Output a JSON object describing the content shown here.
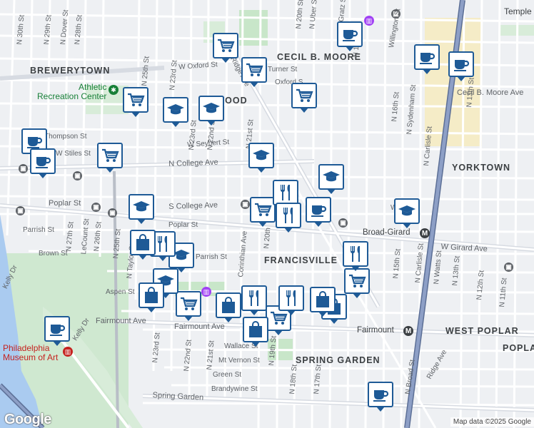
{
  "map": {
    "attribution": "Map data ©2025 Google",
    "logo": "Google",
    "colors": {
      "background": "#eef0f3",
      "park": "#c8e6c9",
      "water": "#aacbf0",
      "highway": "#8d9fc6",
      "marker_border": "#1e5a96",
      "marker_icon": "#1e5a96"
    }
  },
  "areas": {
    "brewerytown": "BREWERYTOWN",
    "cecil_b_moore": "CECIL B. MOORE",
    "yorktown": "YORKTOWN",
    "francisville": "FRANCISVILLE",
    "west_poplar": "WEST POPLAR",
    "spring_garden": "SPRING GARDEN",
    "poplar_partial": "POPLA",
    "sharswood_partial": "AWOOD",
    "temple_partial": "Temple"
  },
  "pois": {
    "athletic_rec_line1": "Athletic",
    "athletic_rec_line2": "Recreation Center",
    "museum_line1": "Philadelphia",
    "museum_line2": "Museum of Art",
    "broad_girard": "Broad-Girard",
    "fairmount_station": "Fairmount"
  },
  "streets": {
    "n30": "N 30th St",
    "n29": "N 29th St",
    "ndover": "N Dover St",
    "n28": "N 28th St",
    "n25": "N 25th St",
    "n23": "N 23rd St",
    "n22": "N 22nd St",
    "n21": "N 21st St",
    "n20": "N 20th St",
    "n20b": "N 20th",
    "n19": "N 19th St",
    "n18": "N 18th St",
    "n17": "N 17th St",
    "n16": "N 16th St",
    "nsydenham": "N Sydenham St",
    "ncarlisle": "N Carlisle St",
    "ncarlisle2": "N Carlisle St",
    "n15": "N 15th St",
    "n13": "N 13th St",
    "n13b": "N 13th St",
    "n12": "N 12th St",
    "n11": "N 11th St",
    "nwatts": "N Watts St",
    "nbroad": "N Broad St",
    "nuber": "N Uber St",
    "nopitz": "N Gratz St",
    "willington": "Willington St",
    "wthompson": "Thompson St",
    "wstiles": "W Stiles St",
    "wseybert": "W Seybert St",
    "wseybert_partial": "W S",
    "wgirard": "W Girard Ave",
    "wgirard2": "W Girard Ave",
    "woxford": "W Oxford St",
    "oxford_partial": "Oxford S",
    "turner": "Turner St",
    "cecilmoore_ave": "Cecil B. Moore Ave",
    "ncollege": "N College Ave",
    "scollege": "S College Ave",
    "poplar": "Poplar St",
    "poplar2": "Poplar St",
    "parrish": "Parrish St",
    "parrish2": "Parrish St",
    "brown": "Brown St",
    "aspen": "Aspen St",
    "fairmount_ave": "Fairmount Ave",
    "fairmount_ave2": "Fairmount Ave",
    "wallace": "Wallace St",
    "mtvernon": "Mt Vernon St",
    "green": "Green St",
    "brandywine": "Brandywine St",
    "springgarden": "Spring Garden",
    "ridge": "Ridge Ave",
    "ridge2": "Ridge Ave",
    "corinthian": "Corinthian Ave",
    "lecount": "LeCount St",
    "n27": "N 27th St",
    "n26": "N 26th St",
    "ntaylor": "N Taylor St",
    "kelly": "Kelly Dr",
    "kelly_partial": "Kelly Dr",
    "n23b": "N 23rd St",
    "n22b": "N 22nd St",
    "n21b": "N 21st St",
    "n19b": "N 19th St",
    "n17b": "N 17th St",
    "n18b": "N 18th St",
    "n15b": "N 15th St",
    "college_partial": "Ave"
  },
  "markers": [
    {
      "type": "cafe",
      "name": "cafe-marker"
    },
    {
      "type": "cafe",
      "name": "cafe-marker"
    },
    {
      "type": "cafe",
      "name": "cafe-marker"
    },
    {
      "type": "cafe",
      "name": "cafe-marker"
    },
    {
      "type": "cafe",
      "name": "cafe-marker"
    },
    {
      "type": "cafe",
      "name": "cafe-marker"
    },
    {
      "type": "cafe",
      "name": "cafe-marker"
    },
    {
      "type": "cafe",
      "name": "cafe-marker"
    },
    {
      "type": "shopping-cart",
      "name": "grocery-marker"
    },
    {
      "type": "shopping-cart",
      "name": "grocery-marker"
    },
    {
      "type": "shopping-cart",
      "name": "grocery-marker"
    },
    {
      "type": "shopping-cart",
      "name": "grocery-marker"
    },
    {
      "type": "shopping-cart",
      "name": "grocery-marker"
    },
    {
      "type": "shopping-cart",
      "name": "grocery-marker"
    },
    {
      "type": "shopping-cart",
      "name": "grocery-marker"
    },
    {
      "type": "shopping-cart",
      "name": "grocery-marker"
    },
    {
      "type": "shopping-cart",
      "name": "grocery-marker"
    },
    {
      "type": "graduation-cap",
      "name": "school-marker"
    },
    {
      "type": "graduation-cap",
      "name": "school-marker"
    },
    {
      "type": "graduation-cap",
      "name": "school-marker"
    },
    {
      "type": "graduation-cap",
      "name": "school-marker"
    },
    {
      "type": "graduation-cap",
      "name": "school-marker"
    },
    {
      "type": "graduation-cap",
      "name": "school-marker"
    },
    {
      "type": "graduation-cap",
      "name": "school-marker"
    },
    {
      "type": "graduation-cap",
      "name": "school-marker"
    },
    {
      "type": "restaurant",
      "name": "restaurant-marker"
    },
    {
      "type": "restaurant",
      "name": "restaurant-marker"
    },
    {
      "type": "restaurant",
      "name": "restaurant-marker"
    },
    {
      "type": "restaurant",
      "name": "restaurant-marker"
    },
    {
      "type": "restaurant",
      "name": "restaurant-marker"
    },
    {
      "type": "restaurant",
      "name": "restaurant-marker"
    },
    {
      "type": "shopping-bag",
      "name": "store-marker"
    },
    {
      "type": "shopping-bag",
      "name": "store-marker"
    },
    {
      "type": "shopping-bag",
      "name": "store-marker"
    },
    {
      "type": "shopping-bag",
      "name": "store-marker"
    },
    {
      "type": "shopping-bag",
      "name": "store-marker"
    },
    {
      "type": "shopping-bag",
      "name": "store-marker"
    }
  ]
}
